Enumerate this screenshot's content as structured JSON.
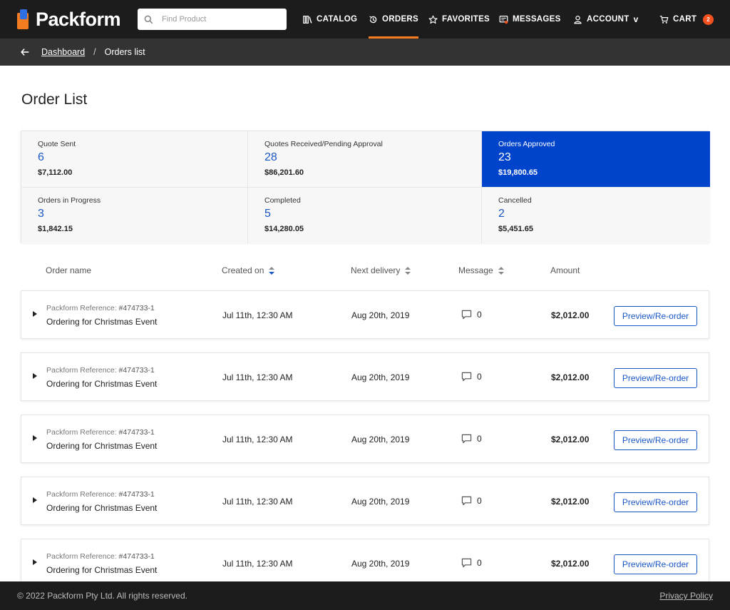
{
  "brand": {
    "name": "Packform"
  },
  "search": {
    "placeholder": "Find Product"
  },
  "nav": {
    "catalog": "CATALOG",
    "orders": "ORDERS",
    "favorites": "FAVORITES",
    "messages": "MESSAGES",
    "account": "ACCOUNT",
    "cart": "CART",
    "cart_count": "2",
    "active": "orders"
  },
  "breadcrumb": {
    "parent": "Dashboard",
    "separator": "/",
    "current": "Orders list"
  },
  "page": {
    "title": "Order List"
  },
  "stats": [
    {
      "label": "Quote Sent",
      "count": "6",
      "amount": "$7,112.00",
      "active": false
    },
    {
      "label": "Quotes Received/Pending Approval",
      "count": "28",
      "amount": "$86,201.60",
      "active": false
    },
    {
      "label": "Orders Approved",
      "count": "23",
      "amount": "$19,800.65",
      "active": true
    },
    {
      "label": "Orders in Progress",
      "count": "3",
      "amount": "$1,842.15",
      "active": false
    },
    {
      "label": "Completed",
      "count": "5",
      "amount": "$14,280.05",
      "active": false
    },
    {
      "label": "Cancelled",
      "count": "2",
      "amount": "$5,451.65",
      "active": false
    }
  ],
  "table": {
    "columns": {
      "order_name": "Order name",
      "created_on": "Created on",
      "next_delivery": "Next delivery",
      "message": "Message",
      "amount": "Amount"
    },
    "rows": [
      {
        "ref_label": "Packform Reference:",
        "ref_number": "#474733-1",
        "name": "Ordering for Christmas Event",
        "created": "Jul 11th, 12:30 AM",
        "delivery": "Aug 20th, 2019",
        "messages": "0",
        "amount": "$2,012.00",
        "action": "Preview/Re-order"
      },
      {
        "ref_label": "Packform Reference:",
        "ref_number": "#474733-1",
        "name": "Ordering for Christmas Event",
        "created": "Jul 11th, 12:30 AM",
        "delivery": "Aug 20th, 2019",
        "messages": "0",
        "amount": "$2,012.00",
        "action": "Preview/Re-order"
      },
      {
        "ref_label": "Packform Reference:",
        "ref_number": "#474733-1",
        "name": "Ordering for Christmas Event",
        "created": "Jul 11th, 12:30 AM",
        "delivery": "Aug 20th, 2019",
        "messages": "0",
        "amount": "$2,012.00",
        "action": "Preview/Re-order"
      },
      {
        "ref_label": "Packform Reference:",
        "ref_number": "#474733-1",
        "name": "Ordering for Christmas Event",
        "created": "Jul 11th, 12:30 AM",
        "delivery": "Aug 20th, 2019",
        "messages": "0",
        "amount": "$2,012.00",
        "action": "Preview/Re-order"
      },
      {
        "ref_label": "Packform Reference:",
        "ref_number": "#474733-1",
        "name": "Ordering for Christmas Event",
        "created": "Jul 11th, 12:30 AM",
        "delivery": "Aug 20th, 2019",
        "messages": "0",
        "amount": "$2,012.00",
        "action": "Preview/Re-order"
      }
    ]
  },
  "footer": {
    "copyright": "© 2022 Packform Pty Ltd. All rights reserved.",
    "privacy": "Privacy Policy"
  },
  "colors": {
    "accent": "#f47b20",
    "primary": "#0044cc",
    "link": "#1a57c7",
    "nav_bg": "#1c1c1c",
    "badge": "#f4511e"
  }
}
